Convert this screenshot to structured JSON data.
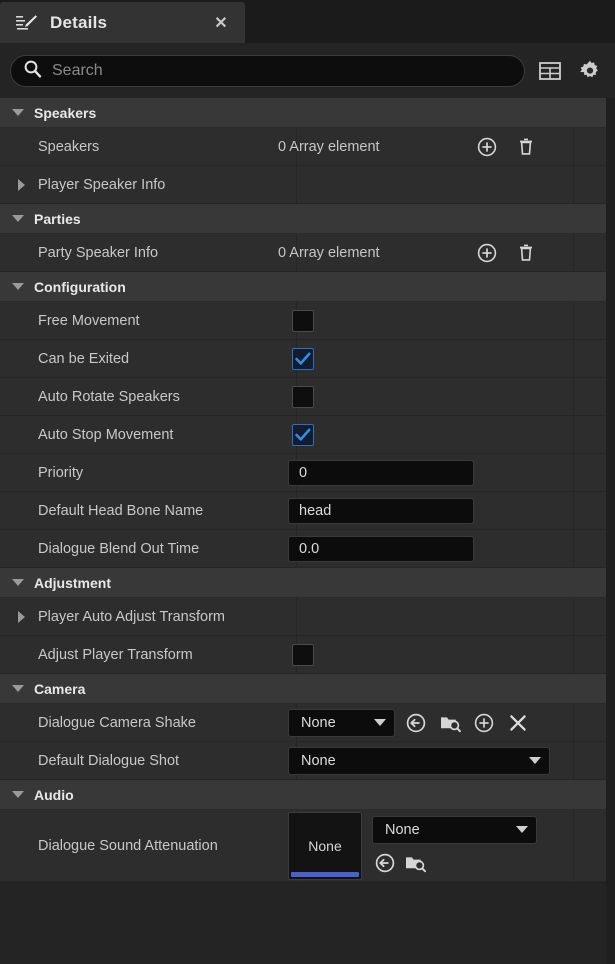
{
  "window": {
    "tab_label": "Details",
    "tab_icon": "details-pencil-icon",
    "close_label": "✕"
  },
  "search": {
    "placeholder": "Search",
    "icon": "search-icon",
    "value": ""
  },
  "toolbar": {
    "columns_icon": "table-columns-icon",
    "settings_icon": "gear-icon"
  },
  "colors": {
    "accent_blue": "#2f8fe8",
    "thumb_bar": "#4a5fd0",
    "section_bg": "#383838",
    "row_bg": "#2d2d2d",
    "panel_bg": "#242424"
  },
  "sections": [
    {
      "title": "Speakers",
      "expanded": true,
      "rows": [
        {
          "label": "Speakers",
          "type": "array",
          "value": "0 Array element",
          "indent": true,
          "actions": [
            "add-icon",
            "delete-icon"
          ]
        },
        {
          "label": "Player Speaker Info",
          "type": "expandable",
          "value": "",
          "expanded": false
        }
      ]
    },
    {
      "title": "Parties",
      "expanded": true,
      "rows": [
        {
          "label": "Party Speaker Info",
          "type": "array",
          "value": "0 Array element",
          "indent": true,
          "actions": [
            "add-icon",
            "delete-icon"
          ]
        }
      ]
    },
    {
      "title": "Configuration",
      "expanded": true,
      "rows": [
        {
          "label": "Free Movement",
          "type": "checkbox",
          "checked": false,
          "indent": true
        },
        {
          "label": "Can be Exited",
          "type": "checkbox",
          "checked": true,
          "indent": true
        },
        {
          "label": "Auto Rotate Speakers",
          "type": "checkbox",
          "checked": false,
          "indent": true
        },
        {
          "label": "Auto Stop Movement",
          "type": "checkbox",
          "checked": true,
          "indent": true
        },
        {
          "label": "Priority",
          "type": "text",
          "value": "0",
          "indent": true
        },
        {
          "label": "Default Head Bone Name",
          "type": "text",
          "value": "head",
          "indent": true
        },
        {
          "label": "Dialogue Blend Out Time",
          "type": "text",
          "value": "0.0",
          "indent": true
        }
      ]
    },
    {
      "title": "Adjustment",
      "expanded": true,
      "rows": [
        {
          "label": "Player Auto Adjust Transform",
          "type": "expandable",
          "value": "",
          "expanded": false
        },
        {
          "label": "Adjust Player Transform",
          "type": "checkbox",
          "checked": false,
          "indent": true
        }
      ]
    },
    {
      "title": "Camera",
      "expanded": true,
      "rows": [
        {
          "label": "Dialogue Camera Shake",
          "type": "asset-small",
          "value": "None",
          "indent": true,
          "actions": [
            "use-selected-asset-icon",
            "browse-asset-icon",
            "add-icon",
            "clear-icon"
          ]
        },
        {
          "label": "Default Dialogue Shot",
          "type": "combo-wide",
          "value": "None",
          "indent": true
        }
      ]
    },
    {
      "title": "Audio",
      "expanded": true,
      "rows": [
        {
          "label": "Dialogue Sound Attenuation",
          "type": "asset-thumb",
          "thumb_label": "None",
          "value": "None",
          "indent": true,
          "actions": [
            "use-selected-asset-icon",
            "browse-asset-icon"
          ]
        }
      ]
    }
  ]
}
